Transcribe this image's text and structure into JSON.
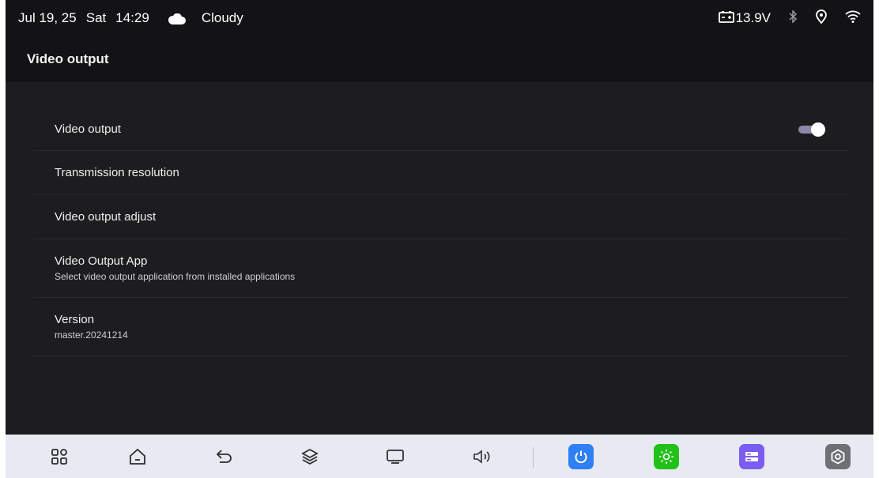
{
  "status_bar": {
    "date": "Jul 19, 25",
    "day": "Sat",
    "time": "14:29",
    "weather": "Cloudy",
    "voltage": "13.9V",
    "icons": [
      "cloud-icon",
      "battery-icon",
      "bluetooth-icon",
      "location-icon",
      "wifi-icon"
    ]
  },
  "page": {
    "title": "Video output"
  },
  "settings": {
    "video_output": {
      "label": "Video output",
      "enabled": true
    },
    "transmission_resolution": {
      "label": "Transmission resolution"
    },
    "video_output_adjust": {
      "label": "Video output adjust"
    },
    "video_output_app": {
      "label": "Video Output App",
      "description": "Select video output application from installed applications"
    },
    "version": {
      "label": "Version",
      "value": "master.20241214"
    }
  },
  "dock": {
    "items": [
      "apps-icon",
      "home-icon",
      "back-icon",
      "layers-icon",
      "screen-icon",
      "volume-icon",
      "power-icon",
      "brightness-icon",
      "storage-icon",
      "settings-icon"
    ]
  },
  "colors": {
    "background": "#1d1d1f",
    "header": "#131315",
    "dock": "#e8eaf2",
    "toggle_track": "#8a8aa8",
    "power_tile": "#2f7ff5",
    "brightness_tile": "#22c11a",
    "storage_tile": "#7b5cf0",
    "settings_tile": "#6f7076"
  }
}
